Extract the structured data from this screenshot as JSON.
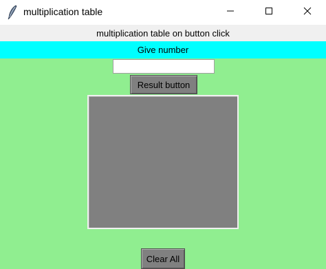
{
  "window": {
    "title": "multiplication table",
    "app_icon": "feather-icon",
    "controls": {
      "minimize_icon": "minimize-icon",
      "maximize_icon": "maximize-icon",
      "close_icon": "close-icon"
    }
  },
  "content": {
    "background_color": "#90ee90",
    "header_label": "multiplication table on button click",
    "header_color": "#f0f0f0",
    "prompt_label": "Give number",
    "prompt_color": "#00ffff",
    "number_input": {
      "value": "",
      "placeholder": ""
    },
    "result_button_label": "Result button",
    "output_text": "",
    "output_color": "#808080",
    "clear_button_label": "Clear All"
  }
}
